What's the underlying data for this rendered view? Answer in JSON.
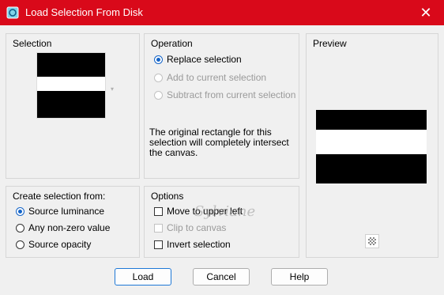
{
  "window": {
    "title": "Load Selection From Disk",
    "close_glyph": "✕"
  },
  "selection_group": {
    "title": "Selection"
  },
  "operation_group": {
    "title": "Operation",
    "options": [
      {
        "label": "Replace selection",
        "selected": true,
        "enabled": true
      },
      {
        "label": "Add to current selection",
        "selected": false,
        "enabled": false
      },
      {
        "label": "Subtract from current selection",
        "selected": false,
        "enabled": false
      }
    ],
    "info": "The original rectangle for this selection will completely intersect the canvas."
  },
  "preview_group": {
    "title": "Preview"
  },
  "create_from_group": {
    "title": "Create selection from:",
    "options": [
      {
        "label": "Source luminance",
        "selected": true
      },
      {
        "label": "Any non-zero value",
        "selected": false
      },
      {
        "label": "Source opacity",
        "selected": false
      }
    ]
  },
  "options_group": {
    "title": "Options",
    "checks": [
      {
        "label": "Move to upper left",
        "checked": false,
        "enabled": true
      },
      {
        "label": "Clip to canvas",
        "checked": false,
        "enabled": false
      },
      {
        "label": "Invert selection",
        "checked": false,
        "enabled": true
      }
    ]
  },
  "buttons": {
    "load": "Load",
    "cancel": "Cancel",
    "help": "Help"
  },
  "watermark": "Sylviane",
  "colors": {
    "titlebar": "#d9091a",
    "accent": "#1464c8"
  }
}
